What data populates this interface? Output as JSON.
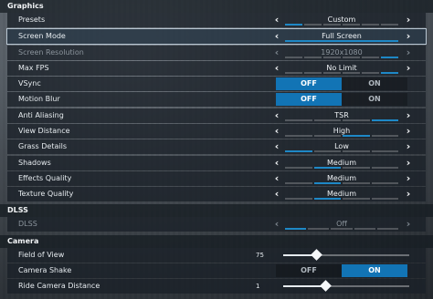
{
  "sections": {
    "graphics": "Graphics",
    "dlss": "DLSS",
    "camera": "Camera"
  },
  "graphics": {
    "presets": {
      "label": "Presets",
      "value": "Custom",
      "segments": 6,
      "active_segment": 1
    },
    "screen_mode": {
      "label": "Screen Mode",
      "value": "Full Screen",
      "segments": 1,
      "active_segment": 1
    },
    "screen_resolution": {
      "label": "Screen Resolution",
      "value": "1920x1080",
      "segments": 6,
      "active_segment": 6
    },
    "max_fps": {
      "label": "Max FPS",
      "value": "No Limit",
      "segments": 6,
      "active_segment": 6
    },
    "vsync": {
      "label": "VSync",
      "off": "OFF",
      "on": "ON",
      "selected": "OFF"
    },
    "motion_blur": {
      "label": "Motion Blur",
      "off": "OFF",
      "on": "ON",
      "selected": "OFF"
    },
    "anti_aliasing": {
      "label": "Anti Aliasing",
      "value": "TSR",
      "segments": 4,
      "active_segment": 4
    },
    "view_distance": {
      "label": "View Distance",
      "value": "High",
      "segments": 4,
      "active_segment": 3
    },
    "grass_details": {
      "label": "Grass Details",
      "value": "Low",
      "segments": 4,
      "active_segment": 1
    },
    "shadows": {
      "label": "Shadows",
      "value": "Medium",
      "segments": 4,
      "active_segment": 2
    },
    "effects_quality": {
      "label": "Effects Quality",
      "value": "Medium",
      "segments": 4,
      "active_segment": 2
    },
    "texture_quality": {
      "label": "Texture Quality",
      "value": "Medium",
      "segments": 4,
      "active_segment": 2
    }
  },
  "dlss": {
    "dlss": {
      "label": "DLSS",
      "value": "Off",
      "segments": 5,
      "active_segment": 1
    }
  },
  "camera": {
    "field_of_view": {
      "label": "Field of View",
      "value": "75",
      "fraction": 0.26
    },
    "camera_shake": {
      "label": "Camera Shake",
      "off": "OFF",
      "on": "ON",
      "selected": "ON"
    },
    "ride_camera_distance": {
      "label": "Ride Camera Distance",
      "value": "1",
      "fraction": 0.33
    }
  },
  "icons": {
    "left": "chevron-left-icon",
    "right": "chevron-right-icon"
  },
  "colors": {
    "accent": "#1274b5",
    "segment_on": "#1e88c6"
  }
}
